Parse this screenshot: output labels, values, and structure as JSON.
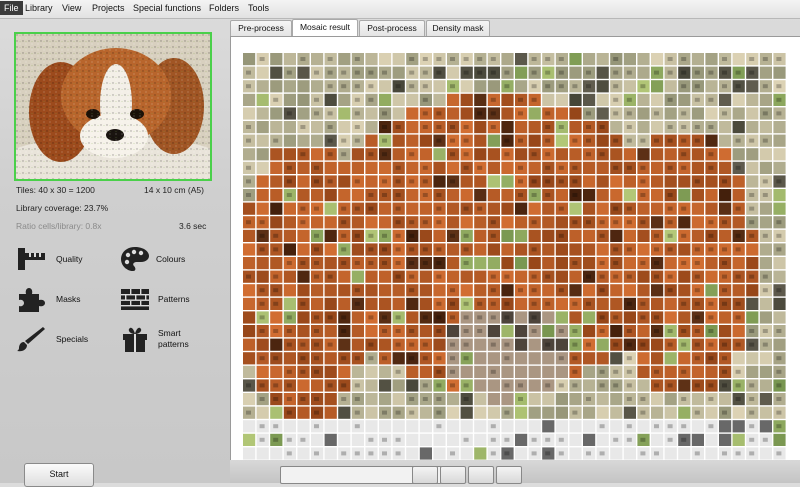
{
  "menu": {
    "items": [
      "File",
      "Library",
      "View",
      "Projects",
      "Special functions",
      "Folders",
      "Tools"
    ],
    "active": "File"
  },
  "preview_icon": "puppy-preview-image",
  "info": {
    "tiles": "Tiles: 40 x 30 = 1200",
    "size": "14 x 10 cm  (A5)",
    "coverage": "Library coverage: 23.7%",
    "ratio": "Ratio cells/library: 0.8x",
    "time": "3.6 sec"
  },
  "tools": {
    "quality": "Quality",
    "colours": "Colours",
    "masks": "Masks",
    "patterns": "Patterns",
    "specials": "Specials",
    "smart_patterns_1": "Smart",
    "smart_patterns_2": "patterns"
  },
  "start_label": "Start",
  "tabs": [
    "Pre-process",
    "Mosaic result",
    "Post-process",
    "Density mask"
  ],
  "selected_tab": "Mosaic result",
  "mosaic": {
    "columns": 40,
    "rows": 30
  },
  "colors": {
    "thumb_border": "#4ad04a",
    "menu_active": "#3b3b3b"
  }
}
